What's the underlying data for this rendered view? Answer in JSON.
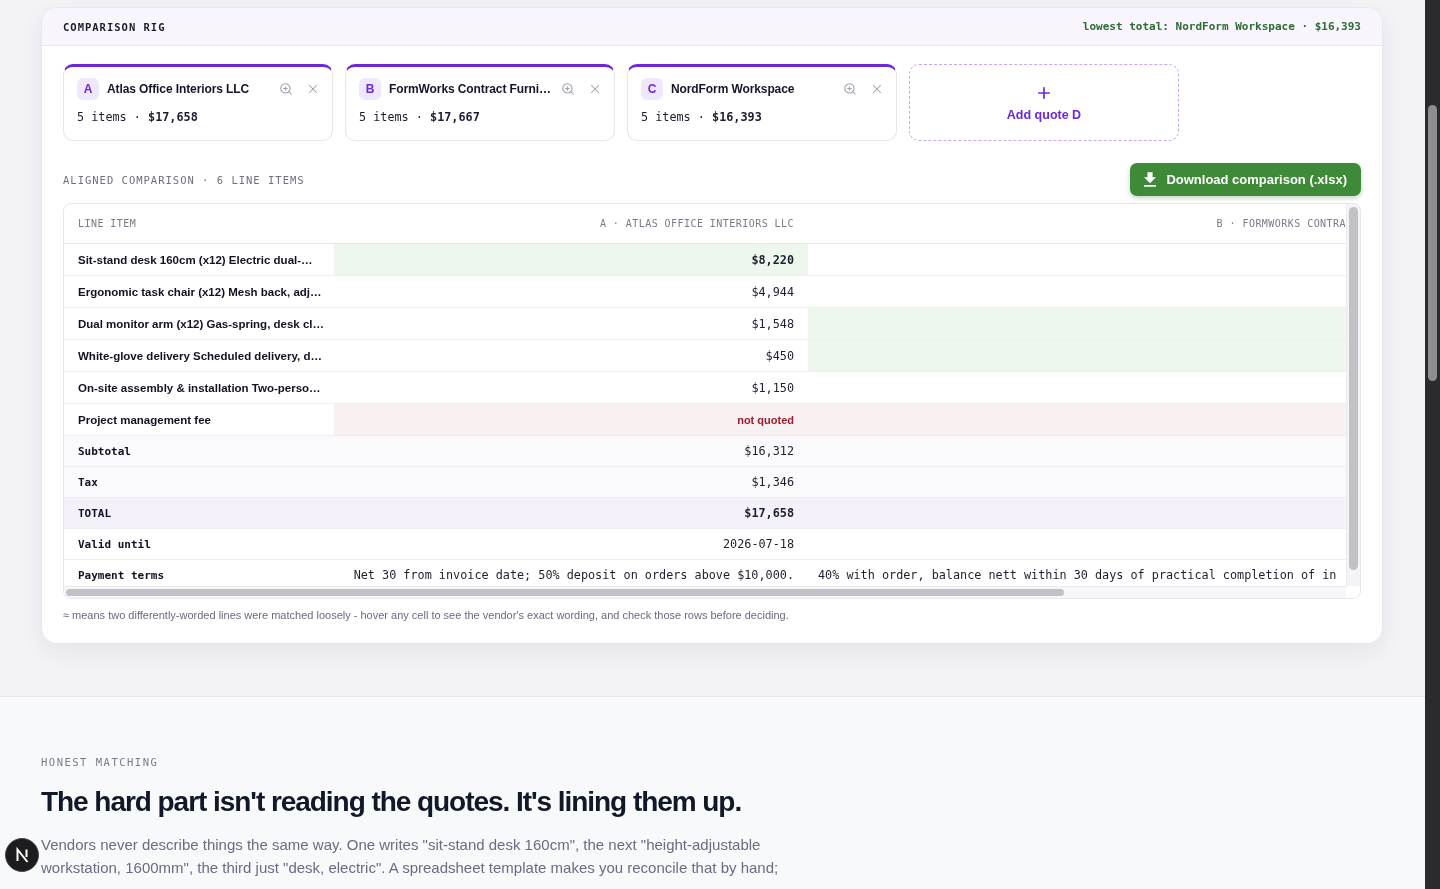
{
  "header": {
    "title": "COMPARISON RIG",
    "summary": "lowest total: NordForm Workspace · $16,393"
  },
  "quotes": [
    {
      "letter": "A",
      "vendor": "Atlas Office Interiors LLC",
      "summary": "5 items · **$17,658**"
    },
    {
      "letter": "B",
      "vendor": "FormWorks Contract Furni…",
      "summary": "5 items · **$17,667**"
    },
    {
      "letter": "C",
      "vendor": "NordForm Workspace",
      "summary": "5 items · **$16,393**"
    }
  ],
  "add_quote": {
    "label": "Add quote D"
  },
  "comparison": {
    "heading": "ALIGNED COMPARISON · 6 LINE ITEMS",
    "download_button": "Download comparison (.xlsx)",
    "label_column": "LINE ITEM",
    "columns": [
      "A · ATLAS OFFICE INTERIORS LLC",
      "B · FORMWORKS CONTRA"
    ],
    "rows": [
      {
        "kind": "item",
        "label": "Sit-stand desk 160cm (x12) Electric dual-…",
        "cells": [
          {
            "value": "$8,220",
            "lowest": true,
            "quoted": true
          },
          {
            "lowest": false,
            "quoted": true
          }
        ]
      },
      {
        "kind": "item",
        "label": "Ergonomic task chair (x12) Mesh back, adj…",
        "cells": [
          {
            "value": "$4,944",
            "lowest": false,
            "quoted": true
          },
          {
            "lowest": false,
            "quoted": true
          }
        ]
      },
      {
        "kind": "item",
        "label": "Dual monitor arm (x12) Gas-spring, desk cl…",
        "cells": [
          {
            "value": "$1,548",
            "lowest": false,
            "quoted": true
          },
          {
            "lowest": true,
            "quoted": true
          }
        ]
      },
      {
        "kind": "item",
        "label": "White-glove delivery Scheduled delivery, d…",
        "cells": [
          {
            "value": "$450",
            "lowest": false,
            "quoted": true
          },
          {
            "lowest": true,
            "quoted": true
          }
        ]
      },
      {
        "kind": "item",
        "label": "On-site assembly & installation Two-perso…",
        "cells": [
          {
            "value": "$1,150",
            "lowest": false,
            "quoted": true
          },
          {
            "lowest": false,
            "quoted": true
          }
        ]
      },
      {
        "kind": "item",
        "label": "Project management fee",
        "cells": [
          {
            "value": "not quoted",
            "quoted": false
          },
          {
            "quoted": false
          }
        ]
      },
      {
        "kind": "subtotal",
        "label": "Subtotal",
        "cells": [
          {
            "value": "$16,312"
          },
          {}
        ]
      },
      {
        "kind": "subtotal",
        "label": "Tax",
        "cells": [
          {
            "value": "$1,346"
          },
          {}
        ]
      },
      {
        "kind": "total",
        "label": "TOTAL",
        "cells": [
          {
            "value": "$17,658"
          },
          {}
        ]
      },
      {
        "kind": "info",
        "label": "Valid until",
        "cells": [
          {
            "value": "2026-07-18"
          },
          {}
        ]
      },
      {
        "kind": "info",
        "label": "Payment terms",
        "cells": [
          {
            "value": "Net 30 from invoice date; 50% deposit on orders above $10,000."
          },
          {
            "value": "40% with order, balance nett within 30 days of practical completion of in"
          }
        ]
      }
    ],
    "footnote": "≈ means two differently-worded lines were matched loosely - hover any cell to see the vendor's exact wording, and check those rows before deciding."
  },
  "section": {
    "eyebrow": "HONEST MATCHING",
    "heading": "The hard part isn't reading the quotes. It's lining them up.",
    "body": "Vendors never describe things the same way. One writes \"sit-stand desk 160cm\", the next \"height-adjustable workstation, 1600mm\", the third just \"desk, electric\". A spreadsheet template makes you reconcile that by hand;"
  }
}
